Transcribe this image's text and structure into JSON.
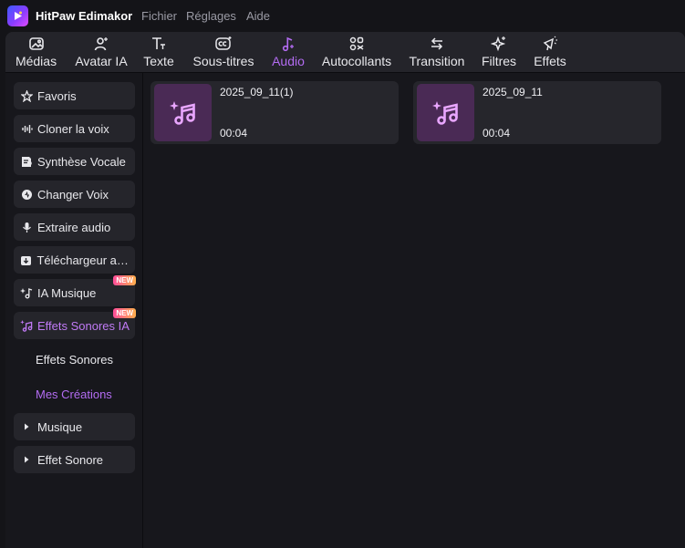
{
  "app": {
    "title": "HitPaw Edimakor",
    "menu": [
      "Fichier",
      "Réglages",
      "Aide"
    ]
  },
  "toolbar": {
    "active_color": "#b36cf2",
    "tabs": [
      {
        "label": "Médias",
        "icon": "media-icon"
      },
      {
        "label": "Avatar IA",
        "icon": "avatar-icon"
      },
      {
        "label": "Texte",
        "icon": "text-icon"
      },
      {
        "label": "Sous-titres",
        "icon": "subtitles-icon"
      },
      {
        "label": "Audio",
        "icon": "audio-icon",
        "active": true
      },
      {
        "label": "Autocollants",
        "icon": "stickers-icon"
      },
      {
        "label": "Transition",
        "icon": "transition-icon"
      },
      {
        "label": "Filtres",
        "icon": "filters-icon"
      },
      {
        "label": "Effets",
        "icon": "effects-icon"
      }
    ]
  },
  "sidebar": {
    "items": [
      {
        "label": "Favoris",
        "icon": "star-icon"
      },
      {
        "label": "Cloner la voix",
        "icon": "waveform-icon"
      },
      {
        "label": "Synthèse Vocale",
        "icon": "text-to-speech-icon"
      },
      {
        "label": "Changer Voix",
        "icon": "voice-changer-icon"
      },
      {
        "label": "Extraire audio",
        "icon": "microphone-icon"
      },
      {
        "label": "Téléchargeur audio",
        "icon": "download-icon"
      },
      {
        "label": "IA Musique",
        "icon": "ai-music-icon",
        "badge": "NEW"
      },
      {
        "label": "Effets Sonores IA",
        "icon": "ai-sound-effects-icon",
        "badge": "NEW",
        "active": true
      }
    ],
    "sub_items": [
      {
        "label": "Effets Sonores"
      },
      {
        "label": "Mes Créations",
        "active": true
      }
    ],
    "collapsed_items": [
      {
        "label": "Musique",
        "icon": "caret-right-icon"
      },
      {
        "label": "Effet Sonore",
        "icon": "caret-right-icon"
      }
    ]
  },
  "content": {
    "cards": [
      {
        "name": "2025_09_11(1)",
        "duration": "00:04",
        "icon": "ai-music-note-icon"
      },
      {
        "name": "2025_09_11",
        "duration": "00:04",
        "icon": "ai-music-note-icon"
      }
    ]
  }
}
